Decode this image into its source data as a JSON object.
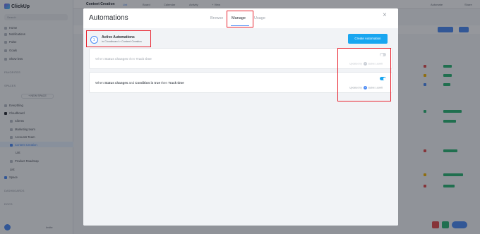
{
  "app": {
    "logo_text": "ClickUp",
    "search_placeholder": "Search",
    "nav": [
      "Home",
      "Notifications",
      "Pulse",
      "Goals",
      "Show less"
    ],
    "sections": {
      "favorites": "FAVORITES",
      "spaces": "SPACES",
      "dashboards": "DASHBOARDS",
      "docs": "DOCS"
    },
    "new_space_label": "+ NEW SPACE",
    "space_items": [
      "Everything",
      "Cloudboard",
      "Clients",
      "Marketing team",
      "Accounts Team",
      "Content Creation",
      "List",
      "Product Roadmap",
      "List",
      "Space"
    ],
    "invite_label": "Invite",
    "topbar": {
      "title": "Content Creation",
      "tabs": [
        "List",
        "Board",
        "Calendar",
        "Activity",
        "+ View"
      ],
      "right": [
        "Automate",
        "Share"
      ]
    },
    "colors": {
      "primary": "#4c8bf5",
      "accent": "#19a6f0",
      "highlight": "#e8232f"
    }
  },
  "modal": {
    "title": "Automations",
    "tabs": [
      {
        "label": "Browse"
      },
      {
        "label": "Manage",
        "active": true
      },
      {
        "label": "Usage"
      }
    ],
    "close_icon": "×",
    "active_header": {
      "count": "1",
      "title": "Active Automations",
      "subtitle": "in Cloudboard > Content Creation"
    },
    "create_button": "Create Automation",
    "automations": [
      {
        "prefix": "When ",
        "trigger": "Status changes",
        "middle1": " then ",
        "action": "Track time",
        "middle2": "",
        "condition": "",
        "enabled": false,
        "updated_by_label": "Updated by",
        "user_initial": "J",
        "user": "Jackie Leavitt"
      },
      {
        "prefix": "When ",
        "trigger": "Status changes",
        "middle1": " and ",
        "condition": "Condition is true",
        "middle2": " then ",
        "action": "Track time",
        "enabled": true,
        "updated_by_label": "Updated by",
        "user_initial": "J",
        "user": "Jackie Leavitt"
      }
    ]
  }
}
